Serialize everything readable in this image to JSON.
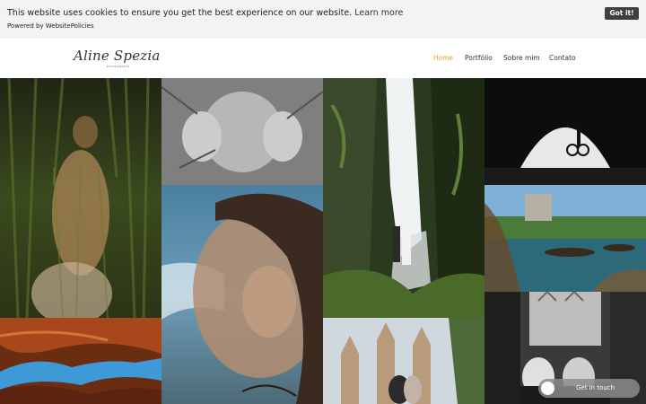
{
  "cookie_banner": {
    "message": "This website uses cookies to ensure you get the best experience on our website.",
    "learn_more": "Learn more",
    "powered_by": "Powered by WebsitePolicies",
    "accept_label": "Got it!"
  },
  "header": {
    "logo_text": "Aline Spezia",
    "logo_sub": "FOTOGRAFIA",
    "nav": [
      {
        "label": "Home",
        "active": true
      },
      {
        "label": "Portfólio",
        "active": false
      },
      {
        "label": "Sobre mim",
        "active": false
      },
      {
        "label": "Contato",
        "active": false
      }
    ],
    "accent_color": "#e5a52b"
  },
  "gallery": {
    "photos": [
      {
        "name": "pregnant-woman-in-grass-photo"
      },
      {
        "name": "child-hands-on-window-photo"
      },
      {
        "name": "woman-face-double-exposure-photo"
      },
      {
        "name": "couple-at-waterfall-photo"
      },
      {
        "name": "tunnel-cyclist-silhouette-photo"
      },
      {
        "name": "central-park-rowboats-photo"
      },
      {
        "name": "antelope-canyon-photo"
      },
      {
        "name": "sagrada-familia-couple-photo"
      },
      {
        "name": "couple-in-barcelona-street-photo"
      }
    ]
  },
  "floating_contact": {
    "label": "Get in touch"
  }
}
